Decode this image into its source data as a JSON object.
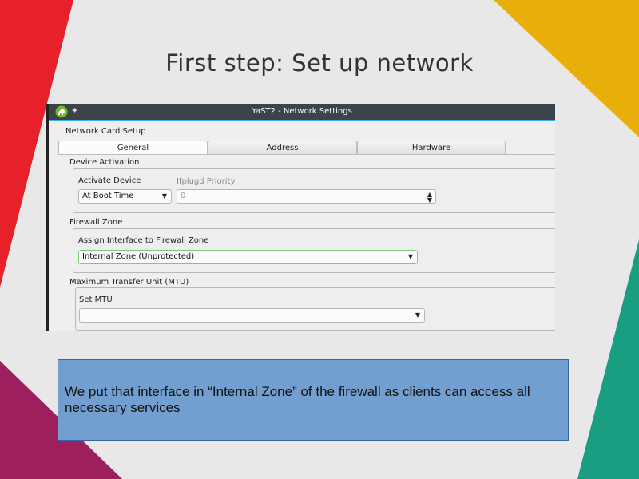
{
  "slide": {
    "title": "First step: Set up network",
    "note": "We put that interface in “Internal Zone” of the firewall as clients can access all necessary services"
  },
  "window": {
    "title": "YaST2 - Network Settings",
    "app_icon": "yast-chameleon-icon",
    "pin_icon": "pin-icon",
    "heading": "Network Card Setup",
    "tabs": [
      {
        "label": "General",
        "active": true
      },
      {
        "label": "Address",
        "active": false
      },
      {
        "label": "Hardware",
        "active": false
      }
    ],
    "device_activation": {
      "legend": "Device Activation",
      "activate_label": "Activate Device",
      "activate_value": "At Boot Time",
      "ifplugd_label": "Ifplugd Priority",
      "ifplugd_value": "0"
    },
    "firewall_zone": {
      "legend": "Firewall Zone",
      "assign_label": "Assign Interface to Firewall Zone",
      "assign_value": "Internal Zone (Unprotected)"
    },
    "mtu": {
      "legend": "Maximum Transfer Unit (MTU)",
      "set_label": "Set MTU",
      "set_value": ""
    }
  },
  "colors": {
    "red": "#e8202a",
    "yellow": "#e8ae0a",
    "teal": "#1a9e82",
    "magenta": "#9e1f5e",
    "note_bg": "#729fcf",
    "titlebar": "#3d4449"
  }
}
